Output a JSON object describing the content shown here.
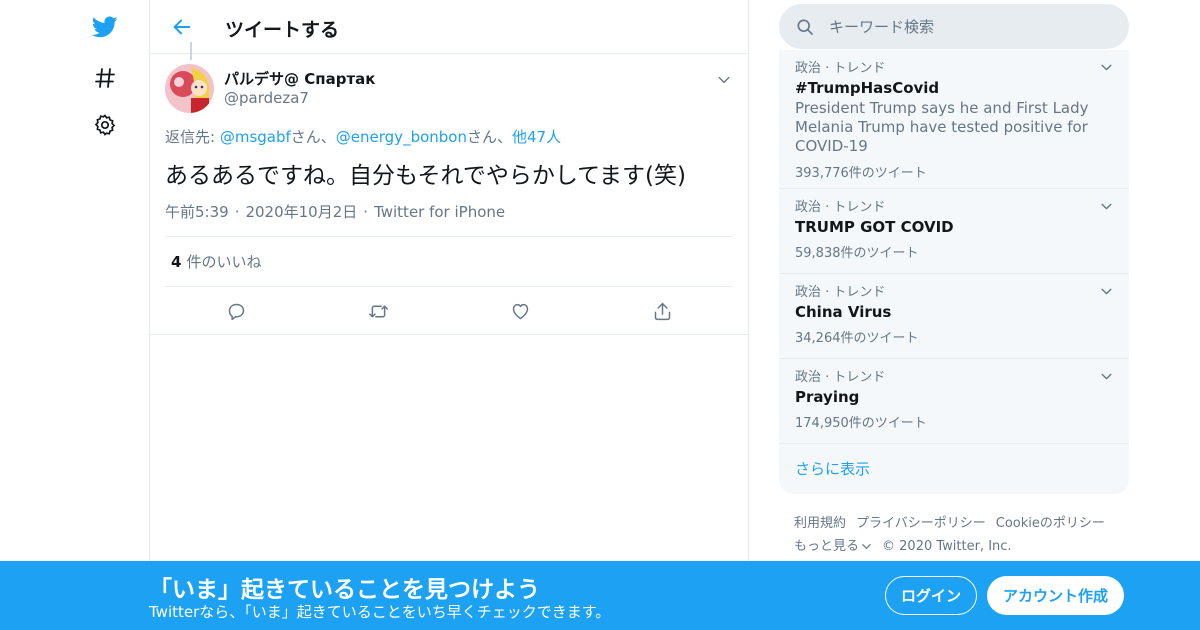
{
  "colors": {
    "accent": "#1da1f2",
    "text": "#14171a",
    "muted": "#657786",
    "border": "#e6ecf0",
    "panel": "#f5f8fa"
  },
  "nav": {
    "items": [
      {
        "icon": "twitter-bird-icon"
      },
      {
        "icon": "hashtag-icon"
      },
      {
        "icon": "gear-icon"
      }
    ]
  },
  "header": {
    "back_icon": "arrow-left-icon",
    "title": "ツイートする"
  },
  "tweet": {
    "author_name": "パルデサ@ Спартак",
    "author_handle": "@pardeza7",
    "reply_prefix": "返信先: ",
    "reply_user1": "@msgabf",
    "reply_sep1": "さん、",
    "reply_user2": "@energy_bonbon",
    "reply_sep2": "さん、",
    "reply_others": "他47人",
    "text": "あるあるですね。自分もそれでやらかしてます(笑)",
    "time": "午前5:39",
    "date": "2020年10月2日",
    "source": "Twitter for iPhone",
    "likes_count": "4",
    "likes_label": "件のいいね",
    "actions": [
      "reply-icon",
      "retweet-icon",
      "like-icon",
      "share-icon"
    ]
  },
  "search": {
    "placeholder": "キーワード検索"
  },
  "trends": {
    "items": [
      {
        "context": "政治 · トレンド",
        "name": "#TrumpHasCovid",
        "description": "President Trump says he and First Lady Melania Trump have tested positive for COVID-19",
        "count": "393,776件のツイート"
      },
      {
        "context": "政治 · トレンド",
        "name": "TRUMP GOT COVID",
        "description": "",
        "count": "59,838件のツイート"
      },
      {
        "context": "政治 · トレンド",
        "name": "China Virus",
        "description": "",
        "count": "34,264件のツイート"
      },
      {
        "context": "政治 · トレンド",
        "name": "Praying",
        "description": "",
        "count": "174,950件のツイート"
      }
    ],
    "show_more": "さらに表示"
  },
  "footer": {
    "links": [
      "利用規約",
      "プライバシーポリシー",
      "Cookieのポリシー",
      "もっと見る"
    ],
    "copyright": "© 2020 Twitter, Inc."
  },
  "banner": {
    "title": "「いま」起きていることを見つけよう",
    "subtitle": "Twitterなら、「いま」起きていることをいち早くチェックできます。",
    "login": "ログイン",
    "signup": "アカウント作成"
  }
}
